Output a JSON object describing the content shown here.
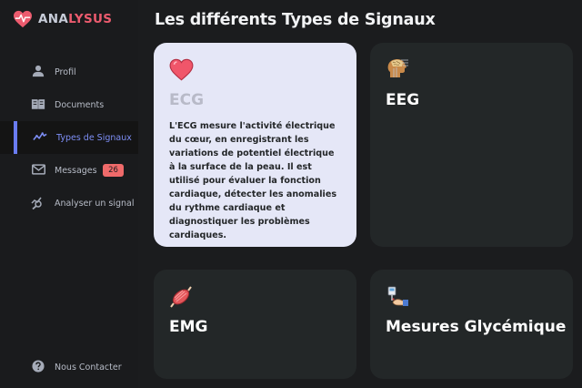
{
  "app": {
    "name_part1": "ANA",
    "name_part2": "LYSUS",
    "logo_icon": "heart-pulse-icon",
    "accent_color": "#ec5b6e"
  },
  "sidebar": {
    "items": [
      {
        "label": "Profil",
        "icon": "user-icon"
      },
      {
        "label": "Documents",
        "icon": "book-icon"
      },
      {
        "label": "Types de Signaux",
        "icon": "signal-line-icon",
        "active": true
      },
      {
        "label": "Messages",
        "icon": "mail-icon",
        "badge": "26"
      },
      {
        "label": "Analyser un signal",
        "icon": "analyze-chart-icon"
      }
    ],
    "footer": {
      "label": "Nous Contacter",
      "icon": "help-circle-icon"
    }
  },
  "main": {
    "title": "Les différents Types de Signaux",
    "cards": [
      {
        "title": "ECG",
        "icon": "heart-icon",
        "selected": true,
        "description": "L'ECG mesure l'activité électrique du cœur, en enregistrant les variations de potentiel électrique à la surface de la peau. Il est utilisé pour évaluer la fonction cardiaque, détecter les anomalies du rythme cardiaque et diagnostiquer les problèmes cardiaques."
      },
      {
        "title": "EEG",
        "icon": "brain-head-icon"
      },
      {
        "title": "EMG",
        "icon": "muscle-icon"
      },
      {
        "title": "Mesures Glycémique",
        "icon": "glucose-meter-icon"
      }
    ]
  }
}
